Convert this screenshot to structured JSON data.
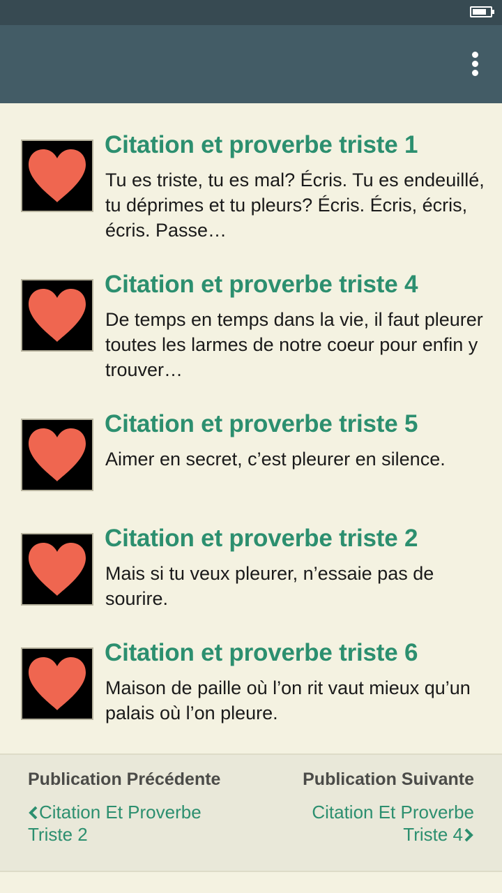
{
  "status_bar": {
    "battery_level": 0.8
  },
  "app_bar": {
    "menu_icon": "more-vert-icon"
  },
  "posts": [
    {
      "title": "Citation et proverbe triste 1",
      "excerpt": "Tu es triste, tu es mal? Écris. Tu es endeuillé, tu déprimes et tu pleurs? Écris. Écris, écris, écris. Passe…",
      "thumbnail_icon": "heart-icon"
    },
    {
      "title": "Citation et proverbe triste 4",
      "excerpt": "De temps en temps dans la vie, il faut pleurer toutes les larmes de notre coeur pour enfin y trouver…",
      "thumbnail_icon": "heart-icon"
    },
    {
      "title": "Citation et proverbe triste 5",
      "excerpt": "Aimer en secret, c’est pleurer en silence.",
      "thumbnail_icon": "heart-icon"
    },
    {
      "title": "Citation et proverbe triste 2",
      "excerpt": "Mais si tu veux pleurer, n’essaie pas de sourire.",
      "thumbnail_icon": "heart-icon"
    },
    {
      "title": "Citation et proverbe triste 6",
      "excerpt": "Maison de paille où l’on rit vaut mieux qu’un palais où l’on pleure.",
      "thumbnail_icon": "heart-icon"
    }
  ],
  "footer_nav": {
    "prev_label": "Publication Précédente",
    "prev_link": "Citation Et Proverbe Triste 2",
    "next_label": "Publication Suivante",
    "next_link": "Citation Et Proverbe Triste 4"
  },
  "colors": {
    "status_bar": "#374a52",
    "app_bar": "#435c66",
    "background": "#f4f2e1",
    "title_accent": "#2c8f6f",
    "heart": "#ef6650",
    "footer_bg": "#e9e8d9"
  }
}
